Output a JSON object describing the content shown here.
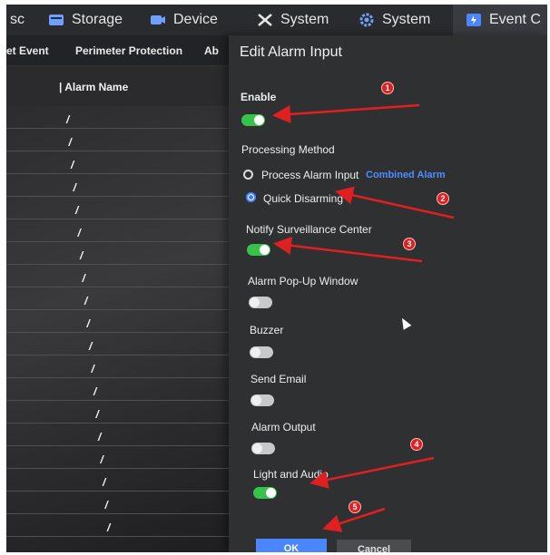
{
  "topnav": [
    {
      "label": "sc",
      "icon": "partial-icon"
    },
    {
      "label": "Storage",
      "icon": "storage-icon"
    },
    {
      "label": "Device",
      "icon": "camera-icon"
    },
    {
      "label": "System",
      "icon": "tools-icon"
    },
    {
      "label": "System",
      "icon": "gear-icon"
    },
    {
      "label": "Event C",
      "icon": "event-center-icon"
    }
  ],
  "subnav": [
    "et Event",
    "Perimeter Protection",
    "Ab"
  ],
  "list": {
    "column_title": "| Alarm Name",
    "rows": [
      "/",
      "/",
      "/",
      "/",
      "/",
      "/",
      "/",
      "/",
      "/",
      "/",
      "/",
      "/",
      "/",
      "/",
      "/",
      "/",
      "/",
      "/",
      "/"
    ]
  },
  "dialog": {
    "title": "Edit Alarm Input",
    "enable_label": "Enable",
    "processing_label": "Processing Method",
    "process_alarm_input_label": "Process Alarm Input",
    "combined_alarm_link": "Combined Alarm",
    "quick_disarming_label": "Quick Disarming",
    "notify_label": "Notify Surveillance Center",
    "popup_label": "Alarm Pop-Up Window",
    "buzzer_label": "Buzzer",
    "email_label": "Send Email",
    "output_label": "Alarm Output",
    "light_audio_label": "Light and Audio",
    "ok_label": "OK",
    "cancel_label": "Cancel",
    "toggles": {
      "enable": true,
      "notify": true,
      "popup": false,
      "buzzer": false,
      "email": false,
      "output": false,
      "light_audio": true
    },
    "processing_selected": "Quick Disarming"
  },
  "annotations": [
    "1",
    "2",
    "3",
    "4",
    "5"
  ],
  "colors": {
    "accent": "#4a86ff",
    "toggle_on": "#37c24a",
    "annotation": "#e02020"
  }
}
